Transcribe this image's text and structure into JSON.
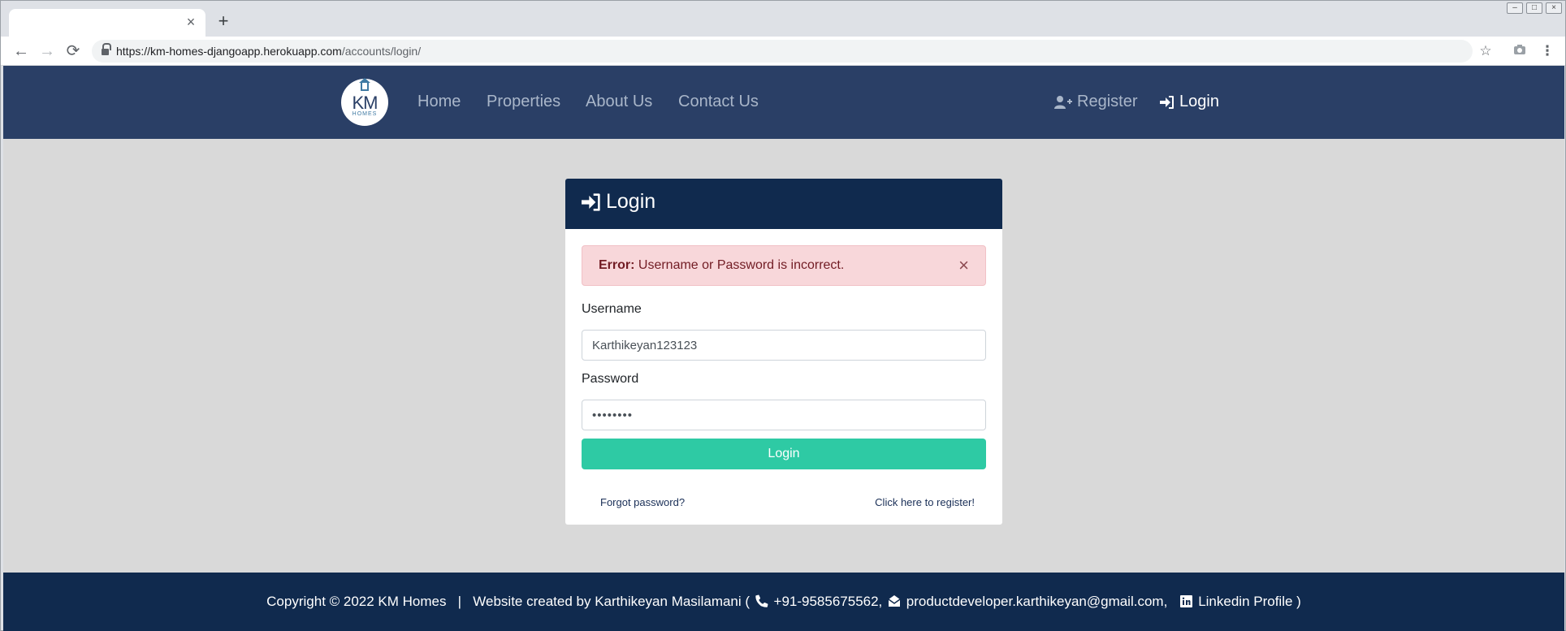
{
  "browser": {
    "tab_title": "",
    "close_tab_glyph": "×",
    "new_tab_glyph": "+",
    "url_host": "https://km-homes-djangoapp.herokuapp.com",
    "url_path": "/accounts/login/"
  },
  "nav": {
    "logo_main": "KM",
    "logo_sub": "HOMES",
    "links": [
      "Home",
      "Properties",
      "About Us",
      "Contact Us"
    ],
    "register": "Register",
    "login": "Login"
  },
  "login_card": {
    "title": "Login",
    "alert_label": "Error:",
    "alert_message": " Username or Password is incorrect.",
    "alert_close": "×",
    "username_label": "Username",
    "username_value": "Karthikeyan123123",
    "password_label": "Password",
    "password_value": "••••••••",
    "submit_label": "Login",
    "forgot_link": "Forgot password?",
    "register_link": "Click here to register!"
  },
  "footer": {
    "copyright": "Copyright © 2022 KM Homes",
    "separator": "|",
    "credit": "Website created by Karthikeyan Masilamani (",
    "phone": "+91-9585675562,",
    "email": "productdeveloper.karthikeyan@gmail.com,",
    "linkedin": "Linkedin Profile )"
  },
  "colors": {
    "navbar": "#2a3f66",
    "card_header": "#102a4e",
    "footer": "#102a4e",
    "accent_button": "#2ecaa4",
    "alert_bg": "#f8d7da"
  },
  "icons": {
    "register": "user-plus-icon",
    "login": "sign-in-icon",
    "phone": "phone-icon",
    "email": "envelope-open-icon",
    "linkedin": "linkedin-icon"
  }
}
